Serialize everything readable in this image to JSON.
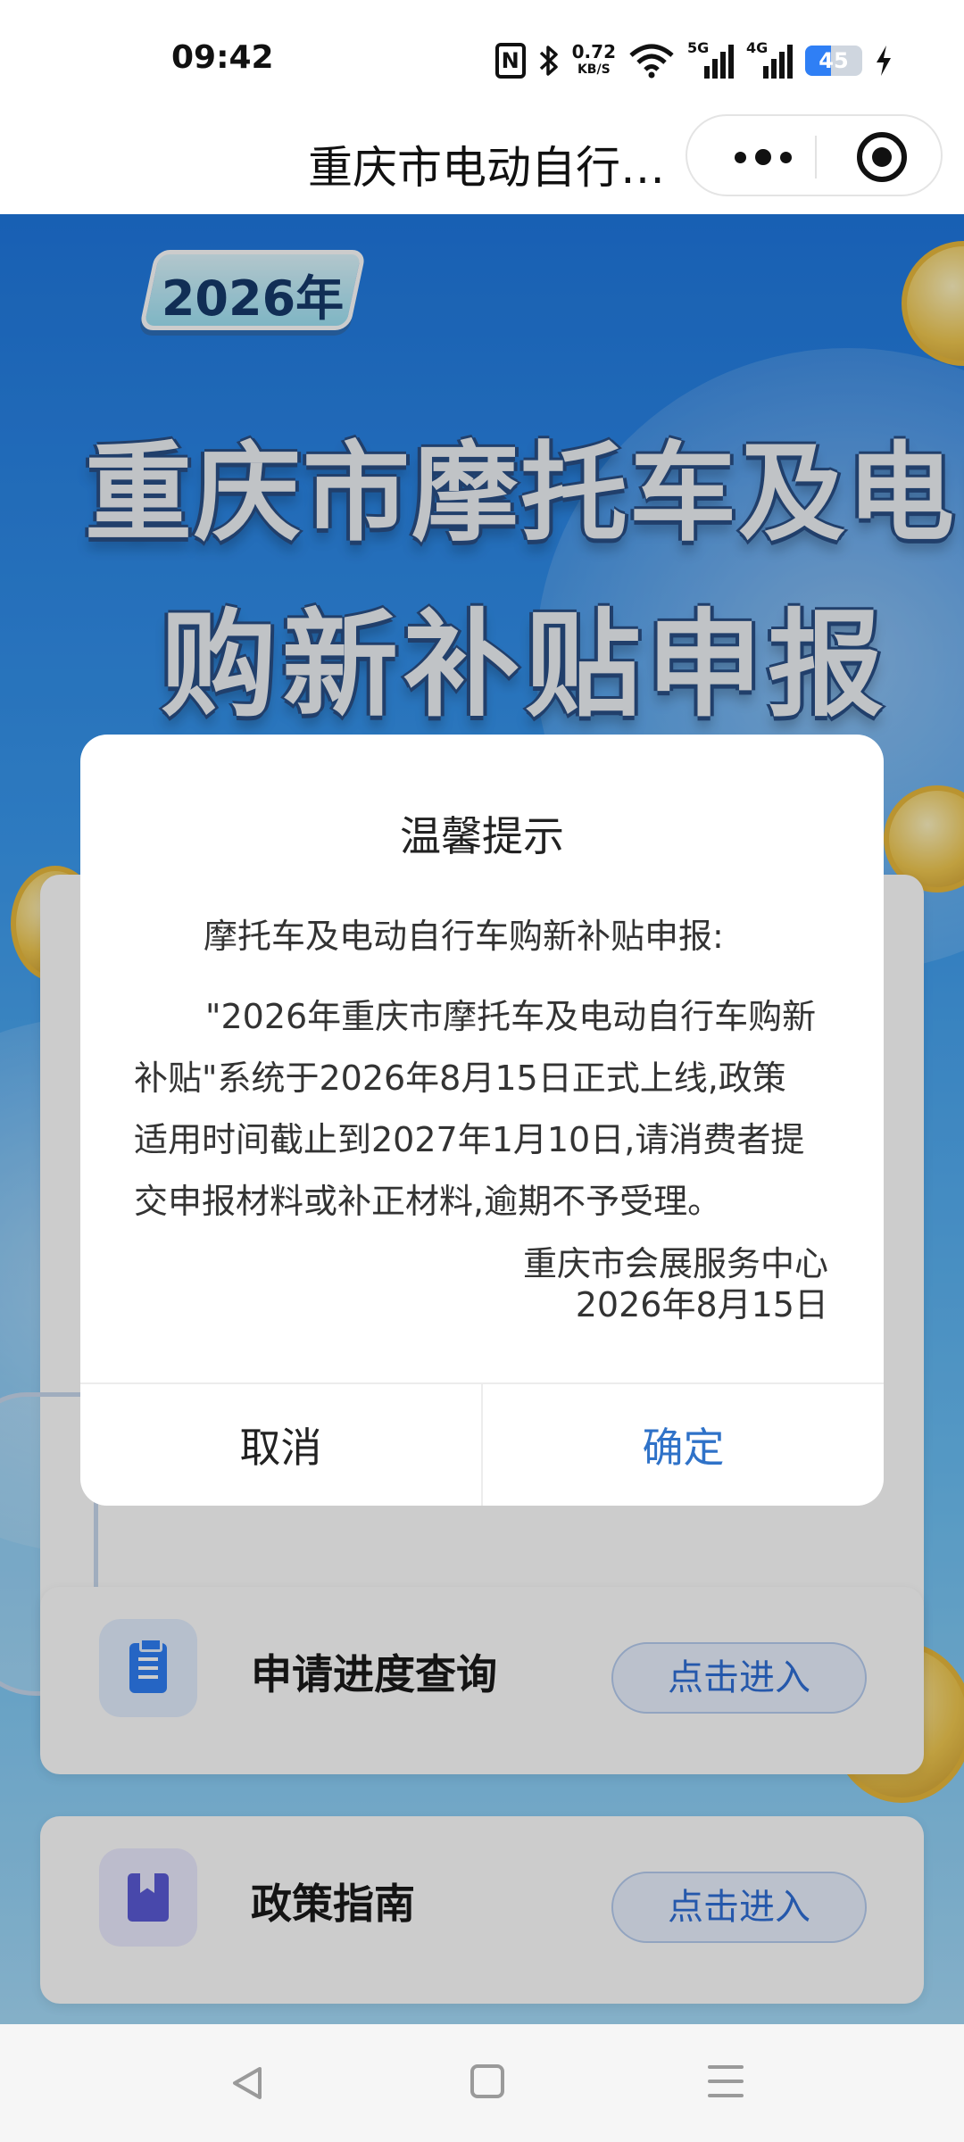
{
  "status_bar": {
    "time": "09:42",
    "icons": [
      "nfc-icon",
      "bluetooth-icon",
      "wifi-icon",
      "signal-5g-icon",
      "signal-4g-icon",
      "battery-icon",
      "charging-icon"
    ],
    "nfc_label": "N",
    "net_speed_value": "0.72",
    "net_speed_unit": "KB/S",
    "signal_1_label": "5G",
    "signal_2_label": "4G",
    "battery_level": "45",
    "battery_fraction": 0.45
  },
  "title_bar": {
    "title": "重庆市电动自行…",
    "more_icon": "more-dots-icon",
    "close_icon": "target-circle-icon"
  },
  "page": {
    "year_badge": "2026年",
    "headline_line1": "重庆市摩托车及电自",
    "headline_line2": "购新补贴申报",
    "items": [
      {
        "label": "申请进度查询",
        "button": "点击进入",
        "icon": "clipboard-icon"
      },
      {
        "label": "政策指南",
        "button": "点击进入",
        "icon": "book-icon"
      }
    ]
  },
  "dialog": {
    "title": "温馨提示",
    "intro": "摩托车及电动自行车购新补贴申报:",
    "body_line1": "\"2026年重庆市摩托车及电动自行车购新",
    "body_line2": "补贴\"系统于2026年8月15日正式上线,政策",
    "body_line3": "适用时间截止到2027年1月10日,请消费者提",
    "body_line4": "交申报材料或补正材料,逾期不予受理。",
    "signature": "重庆市会展服务中心",
    "date": "2026年8月15日",
    "cancel_label": "取消",
    "confirm_label": "确定"
  },
  "nav_bar": {
    "back_icon": "back-triangle-icon",
    "home_icon": "home-square-icon",
    "menu_icon": "menu-lines-icon"
  },
  "colors": {
    "accent_blue": "#2f72c8",
    "page_blue": "#1f78e0",
    "battery_fill": "#2f7ff5"
  }
}
